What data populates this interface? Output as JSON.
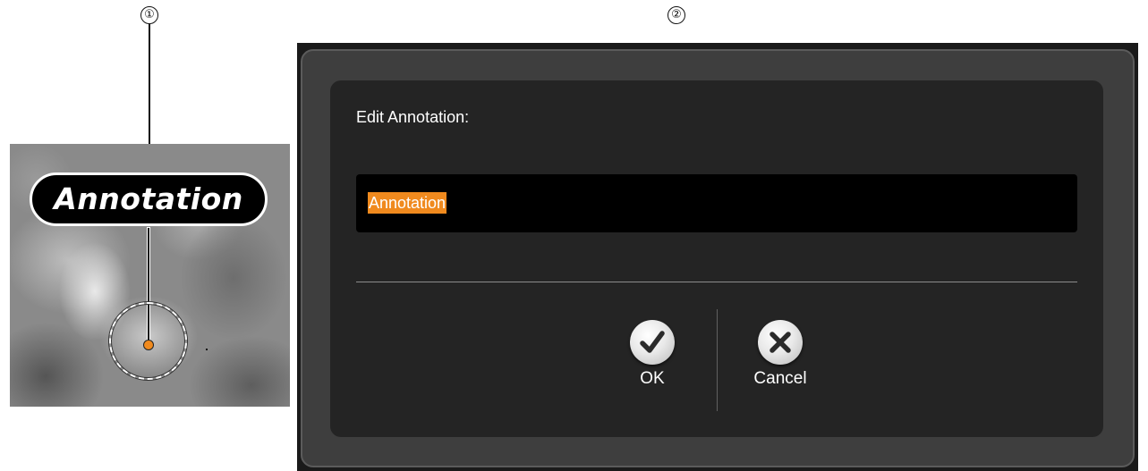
{
  "callouts": {
    "first": "①",
    "second": "②"
  },
  "preview": {
    "annotation_label": "Annotation",
    "marker_color": "#f08a1e"
  },
  "dialog": {
    "title": "Edit Annotation:",
    "input_value": "Annotation",
    "ok_label": "OK",
    "cancel_label": "Cancel",
    "ok_icon": "checkmark-icon",
    "cancel_icon": "x-icon",
    "selection_color": "#f08a1e"
  }
}
